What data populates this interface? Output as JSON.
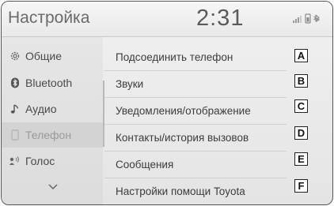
{
  "header": {
    "title": "Настройка",
    "time": "2:31",
    "status_icons": [
      "signal-icon",
      "phone-battery-icon",
      "bluetooth-icon"
    ]
  },
  "sidebar": {
    "items": [
      {
        "label": "Общие",
        "icon": "gear-icon"
      },
      {
        "label": "Bluetooth",
        "icon": "bluetooth-icon"
      },
      {
        "label": "Аудио",
        "icon": "music-note-icon"
      },
      {
        "label": "Телефон",
        "icon": "phone-icon",
        "active": true
      },
      {
        "label": "Голос",
        "icon": "voice-icon"
      }
    ],
    "more_icon": "chevron-down-icon"
  },
  "menu": {
    "items": [
      {
        "label": "Подсоединить телефон",
        "badge": "A"
      },
      {
        "label": "Звуки",
        "badge": "B"
      },
      {
        "label": "Уведомления/отображение",
        "badge": "C"
      },
      {
        "label": "Контакты/история вызовов",
        "badge": "D"
      },
      {
        "label": "Сообщения",
        "badge": "E"
      },
      {
        "label": "Настройки помощи Toyota",
        "badge": "F"
      }
    ]
  }
}
